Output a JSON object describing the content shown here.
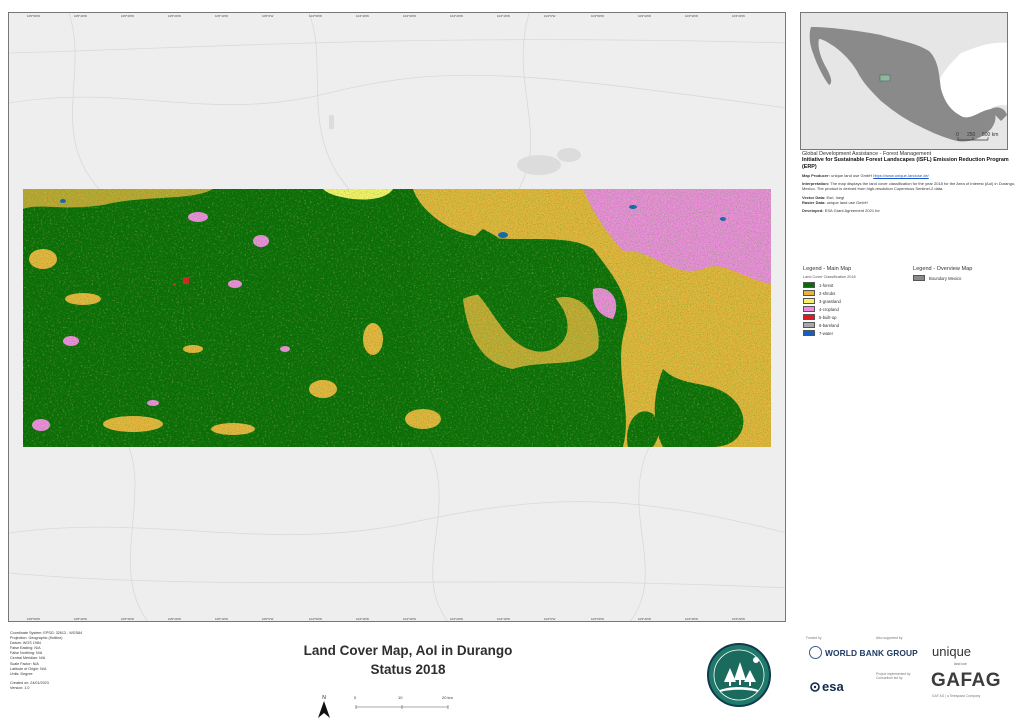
{
  "map": {
    "title_line1": "Land Cover Map, AoI in Durango",
    "title_line2": "Status 2018",
    "top_ticks": [
      "105°50'W",
      "105°40'W",
      "105°30'W",
      "105°20'W",
      "105°10'W",
      "105°0'W",
      "104°50'W",
      "104°40'W",
      "104°30'W",
      "104°20'W",
      "104°10'W",
      "104°0'W",
      "103°50'W",
      "103°40'W",
      "103°30'W",
      "103°20'W"
    ],
    "bottom_ticks": [
      "105°50'W",
      "105°40'W",
      "105°30'W",
      "105°20'W",
      "105°10'W",
      "105°0'W",
      "104°50'W",
      "104°40'W",
      "104°30'W",
      "104°20'W",
      "104°10'W",
      "104°0'W",
      "103°50'W",
      "103°40'W",
      "103°30'W",
      "103°20'W"
    ]
  },
  "overview": {
    "scale_0": "0",
    "scale_mid": "250",
    "scale_end": "500 km"
  },
  "info": {
    "org": "Global Development Assistance - Forest Management",
    "project": "Initiative for Sustainable Forest Landscapes (ISFL) Emission Reduction Program (ERP)",
    "producer_label": "Map Producer:",
    "producer_text": "unique land use GmbH",
    "producer_link": "https://www.unique-landuse.de/",
    "interp_label": "Interpretation:",
    "interp_text": "The map displays the land cover classification for the year 2018 for the Area of Interest (AoI) in Durango, Mexico. The product is derived from high-resolution Copernicus Sentinel-2 data.",
    "vector_label": "Vector Data:",
    "vector_text": "Esri, Inegi",
    "raster_label": "Raster Data:",
    "raster_text": "unique land use GmbH",
    "developed_label": "Developed:",
    "developed_text": "ESA Grant Agreement 2021 for"
  },
  "legend_main": {
    "title": "Legend - Main Map",
    "subtitle": "Land Cover Classification 2018",
    "items": [
      {
        "label": "1-forest",
        "color": "#0b6b06"
      },
      {
        "label": "2-shrubs",
        "color": "#e8b43c"
      },
      {
        "label": "3-grassland",
        "color": "#f6f268"
      },
      {
        "label": "4-cropland",
        "color": "#f08ae0"
      },
      {
        "label": "5-built-up",
        "color": "#e01a24"
      },
      {
        "label": "6-bareland",
        "color": "#a8a8a8"
      },
      {
        "label": "7-water",
        "color": "#1460c0"
      }
    ]
  },
  "legend_overview": {
    "title": "Legend - Overview Map",
    "items": [
      {
        "label": "Boundary Mexico",
        "color": "#8a8a8a"
      }
    ]
  },
  "meta": {
    "lines": [
      "Coordinate System: EPSG: 32613 - WGS84",
      "Projection: Geographic (Hotline)",
      "Datum: WGS 1984",
      "False Easting: N/A",
      "False Northing: N/A",
      "Central Meridian: N/A",
      "Scale Factor: N/A",
      "Latitude of Origin: N/A",
      "Units: Degree"
    ],
    "created": "Created on: 24/01/2023",
    "version": "Version: 1.0"
  },
  "scale": {
    "l0": "0",
    "l10": "10",
    "l20": "20 km",
    "north": "N"
  },
  "partners": {
    "funded_by": "Funded by",
    "supported_by": "Also supported by",
    "world_bank": "WORLD BANK GROUP",
    "esa": "esa",
    "esa_caption": "Project implemented by Consortium led by",
    "unique": "unique",
    "unique_sub": "land use",
    "gafag": "GAFAG",
    "gafag_caption": "GAF AG | a Telespazio Company"
  }
}
